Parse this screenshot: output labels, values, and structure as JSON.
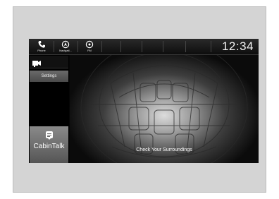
{
  "topbar": {
    "buttons": [
      {
        "label": "Phone",
        "icon": "phone-icon"
      },
      {
        "label": "Navigati...",
        "icon": "navigation-icon"
      },
      {
        "label": "FM",
        "icon": "radio-icon"
      }
    ],
    "clock": "12:34"
  },
  "sidebar": {
    "camera_icon": "camera-icon",
    "settings_label": "Settings",
    "cabintalk_label": "CabinTalk",
    "cabintalk_icon": "cabintalk-icon"
  },
  "main": {
    "message": "Check Your Surroundings"
  },
  "colors": {
    "frame": "#d4d4d4",
    "screen": "#050505",
    "button_gray": "#6a6a6a",
    "text": "#ffffff"
  }
}
